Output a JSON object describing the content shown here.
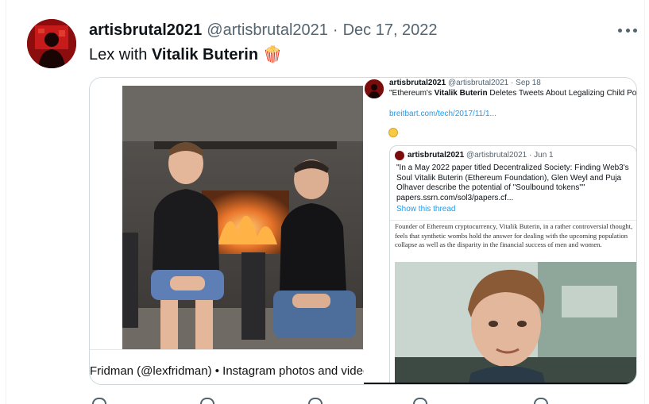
{
  "tweet": {
    "display_name": "artisbrutal2021",
    "handle": "@artisbrutal2021",
    "separator": "·",
    "date": "Dec 17, 2022",
    "text_prefix": "Lex with ",
    "text_bold": "Vitalik Buterin",
    "text_emoji": "🍿",
    "more_icon": "more-horizontal-icon"
  },
  "media_left": {
    "caption": "Fridman (@lexfridman) • Instagram photos and videos"
  },
  "media_right": {
    "author_name": "artisbrutal2021",
    "author_handle": "@artisbrutal2021",
    "separator": "·",
    "date": "Sep 18",
    "text_prefix": "\"Ethereum's ",
    "text_bold": "Vitalik Buterin",
    "text_suffix": " Deletes Tweets About Legalizing Child Porn\"",
    "link": "breitbart.com/tech/2017/11/1...",
    "emoji_icon": "thinking-face-icon",
    "quote": {
      "author_name": "artisbrutal2021",
      "author_handle": "@artisbrutal2021",
      "separator": "·",
      "date": "Jun 1",
      "text": "\"In a May 2022 paper titled Decentralized Society: Finding Web3's Soul Vitalik Buterin (Ethereum Foundation), Glen Weyl and Puja Olhaver describe the potential of \"Soulbound tokens\"\" papers.ssrn.com/sol3/papers.cf...",
      "show_thread": "Show this thread",
      "article_text": "Founder of Ethereum cryptocurrency, Vitalik Buterin, in a rather controversial thought, feels that synthetic wombs hold the answer for dealing with the upcoming population collapse as well as the disparity in the financial success of men and women."
    }
  },
  "colors": {
    "text": "#0f1419",
    "secondary": "#536471",
    "link": "#1d9bf0",
    "border": "#cfd9de"
  }
}
